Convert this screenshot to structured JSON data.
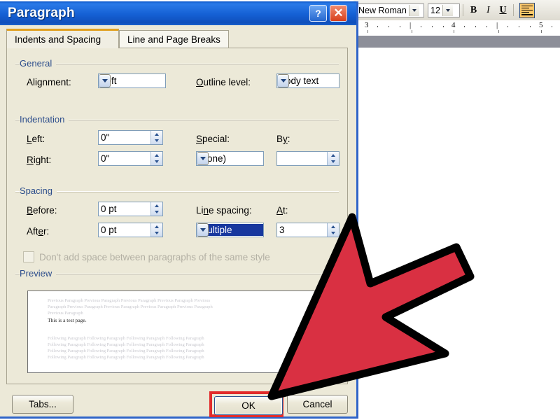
{
  "dialog": {
    "title": "Paragraph",
    "help_button": "?",
    "close_button": "✕",
    "tabs": [
      {
        "label": "Indents and Spacing",
        "active": true
      },
      {
        "label": "Line and Page Breaks",
        "active": false
      }
    ],
    "general": {
      "group_title": "General",
      "alignment_label": "Alignment:",
      "alignment_value": "Left",
      "outline_label": "Outline level:",
      "outline_value": "Body text"
    },
    "indentation": {
      "group_title": "Indentation",
      "left_label": "Left:",
      "left_value": "0\"",
      "right_label": "Right:",
      "right_value": "0\"",
      "special_label": "Special:",
      "special_value": "(none)",
      "by_label": "By:",
      "by_value": ""
    },
    "spacing": {
      "group_title": "Spacing",
      "before_label": "Before:",
      "before_value": "0 pt",
      "after_label": "After:",
      "after_value": "0 pt",
      "line_spacing_label": "Line spacing:",
      "line_spacing_value": "Multiple",
      "at_label": "At:",
      "at_value": "3",
      "checkbox_label": "Don't add space between paragraphs of the same style",
      "checkbox_checked": false,
      "checkbox_disabled": true
    },
    "preview": {
      "group_title": "Preview",
      "previous_lines": [
        "Previous Paragraph Previous Paragraph Previous Paragraph Previous Paragraph Previous",
        "Paragraph Previous Paragraph Previous Paragraph Previous Paragraph Previous Paragraph",
        "Previous Paragraph"
      ],
      "current_line": "This is a test page.",
      "following_lines": [
        "Following Paragraph Following Paragraph Following Paragraph Following Paragraph",
        "Following Paragraph Following Paragraph Following Paragraph Following Paragraph",
        "Following Paragraph Following Paragraph Following Paragraph Following Paragraph",
        "Following Paragraph Following Paragraph Following Paragraph Following Paragraph"
      ]
    },
    "buttons": {
      "tabs": "Tabs...",
      "ok": "OK",
      "cancel": "Cancel"
    }
  },
  "word_toolbar": {
    "font_name": "New Roman",
    "font_size": "12",
    "bold": "B",
    "italic": "I",
    "underline": "U",
    "align_left_icon": "align-left-icon"
  },
  "ruler": {
    "marks": [
      "3",
      "|",
      "4",
      "|",
      "5"
    ]
  },
  "annotation": {
    "arrow_color": "#d93042",
    "arrow_outline": "#000000",
    "highlight_color": "#e12b2b",
    "points_to": "OK"
  },
  "colors": {
    "titlebar_blue": "#1560d4",
    "dialog_face": "#ece9d8",
    "group_title_blue": "#2d4e8c",
    "selection_blue": "#17379e",
    "active_tab_accent": "#e0a020"
  }
}
